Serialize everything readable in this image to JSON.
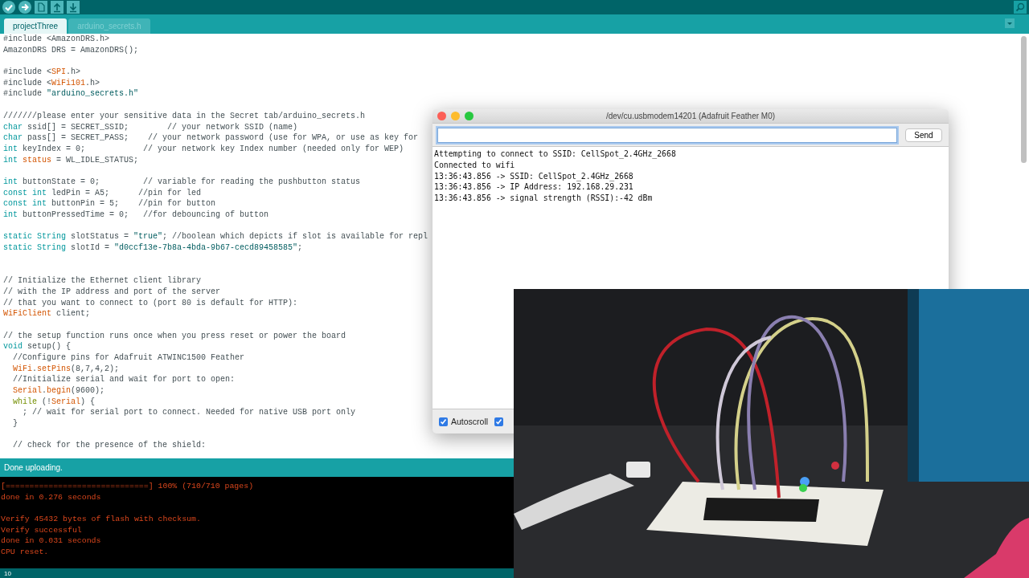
{
  "tabs": [
    {
      "label": "projectThree",
      "selected": true
    },
    {
      "label": "arduino_secrets.h",
      "selected": false
    }
  ],
  "editor": {
    "lines": [
      {
        "kind": "code",
        "spans": [
          {
            "text": "#include <AmazonDRS.h>"
          }
        ]
      },
      {
        "kind": "code",
        "spans": [
          {
            "text": "AmazonDRS DRS = AmazonDRS();"
          }
        ]
      },
      {
        "kind": "blank"
      },
      {
        "kind": "code",
        "spans": [
          {
            "text": "#include <"
          },
          {
            "text": "SPI",
            "kind": "lib"
          },
          {
            "text": ".h>"
          }
        ]
      },
      {
        "kind": "code",
        "spans": [
          {
            "text": "#include <"
          },
          {
            "text": "WiFi101",
            "kind": "lib"
          },
          {
            "text": ".h>"
          }
        ]
      },
      {
        "kind": "code",
        "spans": [
          {
            "text": "#include "
          },
          {
            "text": "\"arduino_secrets.h\"",
            "kind": "string"
          }
        ]
      },
      {
        "kind": "blank"
      },
      {
        "kind": "code",
        "spans": [
          {
            "text": "///////please enter your sensitive data in the Secret tab/arduino_secrets.h"
          }
        ]
      },
      {
        "kind": "code",
        "spans": [
          {
            "text": "char",
            "kind": "type"
          },
          {
            "text": " ssid[] = SECRET_SSID;        // your network SSID (name)"
          }
        ]
      },
      {
        "kind": "code",
        "spans": [
          {
            "text": "char",
            "kind": "type"
          },
          {
            "text": " pass[] = SECRET_PASS;    // your network password (use for WPA, or use as key for"
          }
        ]
      },
      {
        "kind": "code",
        "spans": [
          {
            "text": "int",
            "kind": "type"
          },
          {
            "text": " keyIndex = 0;            // your network key Index number (needed only for WEP)"
          }
        ]
      },
      {
        "kind": "code",
        "spans": [
          {
            "text": "int",
            "kind": "type"
          },
          {
            "text": " status",
            "kind": "lib"
          },
          {
            "text": " = WL_IDLE_STATUS;"
          }
        ]
      },
      {
        "kind": "blank"
      },
      {
        "kind": "code",
        "spans": [
          {
            "text": "int",
            "kind": "type"
          },
          {
            "text": " buttonState = 0;         // variable for reading the pushbutton status"
          }
        ]
      },
      {
        "kind": "code",
        "spans": [
          {
            "text": "const int",
            "kind": "type"
          },
          {
            "text": " ledPin = A5;      //pin for led"
          }
        ]
      },
      {
        "kind": "code",
        "spans": [
          {
            "text": "const int",
            "kind": "type"
          },
          {
            "text": " buttonPin = 5;    //pin for button"
          }
        ]
      },
      {
        "kind": "code",
        "spans": [
          {
            "text": "int",
            "kind": "type"
          },
          {
            "text": " buttonPressedTime = 0;   //for debouncing of button"
          }
        ]
      },
      {
        "kind": "blank"
      },
      {
        "kind": "code",
        "spans": [
          {
            "text": "static String",
            "kind": "type"
          },
          {
            "text": " slotStatus = "
          },
          {
            "text": "\"true\"",
            "kind": "string"
          },
          {
            "text": "; //boolean which depicts if slot is available for repl"
          }
        ]
      },
      {
        "kind": "code",
        "spans": [
          {
            "text": "static String",
            "kind": "type"
          },
          {
            "text": " slotId = "
          },
          {
            "text": "\"d0ccf13e-7b8a-4bda-9b67-cecd89458585\"",
            "kind": "string"
          },
          {
            "text": ";"
          }
        ]
      },
      {
        "kind": "blank"
      },
      {
        "kind": "blank"
      },
      {
        "kind": "code",
        "spans": [
          {
            "text": "// Initialize the Ethernet client library"
          }
        ]
      },
      {
        "kind": "code",
        "spans": [
          {
            "text": "// with the IP address and port of the server"
          }
        ]
      },
      {
        "kind": "code",
        "spans": [
          {
            "text": "// that you want to connect to (port 80 is default for HTTP):"
          }
        ]
      },
      {
        "kind": "code",
        "spans": [
          {
            "text": "WiFiClient",
            "kind": "lib"
          },
          {
            "text": " client;"
          }
        ]
      },
      {
        "kind": "blank"
      },
      {
        "kind": "code",
        "spans": [
          {
            "text": "// the setup function runs once when you press reset or power the board"
          }
        ]
      },
      {
        "kind": "code",
        "spans": [
          {
            "text": "void",
            "kind": "type"
          },
          {
            "text": " setup() {"
          }
        ]
      },
      {
        "kind": "code",
        "spans": [
          {
            "text": "  //Configure pins for Adafruit ATWINC1500 Feather"
          }
        ]
      },
      {
        "kind": "code",
        "spans": [
          {
            "text": "  WiFi",
            "kind": "lib"
          },
          {
            "text": "."
          },
          {
            "text": "setPins",
            "kind": "lib"
          },
          {
            "text": "(8,7,4,2);"
          }
        ]
      },
      {
        "kind": "code",
        "spans": [
          {
            "text": "  //Initialize serial and wait for port to open:"
          }
        ]
      },
      {
        "kind": "code",
        "spans": [
          {
            "text": "  Serial",
            "kind": "lib"
          },
          {
            "text": "."
          },
          {
            "text": "begin",
            "kind": "lib"
          },
          {
            "text": "(9600);"
          }
        ]
      },
      {
        "kind": "code",
        "spans": [
          {
            "text": "  while",
            "kind": "keyword"
          },
          {
            "text": " (!"
          },
          {
            "text": "Serial",
            "kind": "lib"
          },
          {
            "text": ") {"
          }
        ]
      },
      {
        "kind": "code",
        "spans": [
          {
            "text": "    ; // wait for serial port to connect. Needed for native USB port only"
          }
        ]
      },
      {
        "kind": "code",
        "spans": [
          {
            "text": "  }"
          }
        ]
      },
      {
        "kind": "blank"
      },
      {
        "kind": "code",
        "spans": [
          {
            "text": "  // check for the presence of the shield:"
          }
        ]
      }
    ]
  },
  "status_message": "Done uploading.",
  "console_lines": [
    {
      "kind": "text",
      "text": "[==============================] 100% (710/710 pages)"
    },
    {
      "kind": "text",
      "text": "done in 0.276 seconds"
    },
    {
      "kind": "blank"
    },
    {
      "kind": "text",
      "text": "Verify 45432 bytes of flash with checksum."
    },
    {
      "kind": "text",
      "text": "Verify successful"
    },
    {
      "kind": "text",
      "text": "done in 0.031 seconds"
    },
    {
      "kind": "text",
      "text": "CPU reset."
    }
  ],
  "line_number": "10",
  "serial_monitor": {
    "title": "/dev/cu.usbmodem14201 (Adafruit Feather M0)",
    "send_label": "Send",
    "output": [
      "Attempting to connect to SSID: CellSpot_2.4GHz_2668",
      "Connected to wifi",
      "13:36:43.856 -> SSID: CellSpot_2.4GHz_2668",
      "13:36:43.856 -> IP Address: 192.168.29.231",
      "13:36:43.856 -> signal strength (RSSI):-42 dBm"
    ],
    "options": [
      {
        "label": "Autoscroll",
        "checked": true
      },
      {
        "checked": true
      }
    ]
  }
}
